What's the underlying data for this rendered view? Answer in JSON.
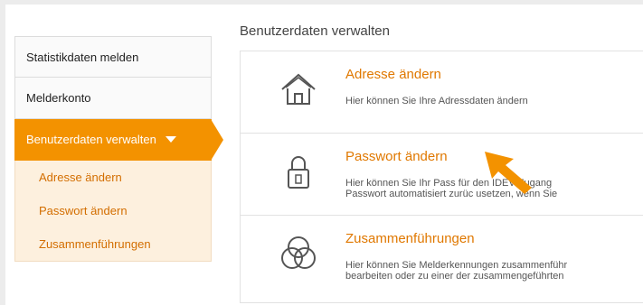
{
  "sidebar": {
    "items": [
      {
        "label": "Statistikdaten melden"
      },
      {
        "label": "Melderkonto"
      },
      {
        "label": "Benutzerdaten verwalten"
      }
    ],
    "subitems": [
      {
        "label": "Adresse ändern"
      },
      {
        "label": "Passwort ändern"
      },
      {
        "label": "Zusammenführungen"
      }
    ]
  },
  "main": {
    "heading": "Benutzerdaten verwalten",
    "cards": [
      {
        "title": "Adresse ändern",
        "desc1": "Hier können Sie Ihre Adressdaten ändern",
        "icon": "house-icon"
      },
      {
        "title": "Passwort ändern",
        "desc1": "Hier können Sie Ihr Pass     für den IDEV-Zugang",
        "desc2": "Passwort automatisiert zurüc    usetzen, wenn Sie",
        "icon": "padlock-icon"
      },
      {
        "title": "Zusammenführungen",
        "desc1": "Hier können Sie Melderkennungen zusammenführ",
        "desc2": "bearbeiten oder zu einer der zusammengeführten",
        "icon": "circles-icon"
      }
    ]
  },
  "colors": {
    "accent": "#f39200",
    "link": "#e07800"
  }
}
